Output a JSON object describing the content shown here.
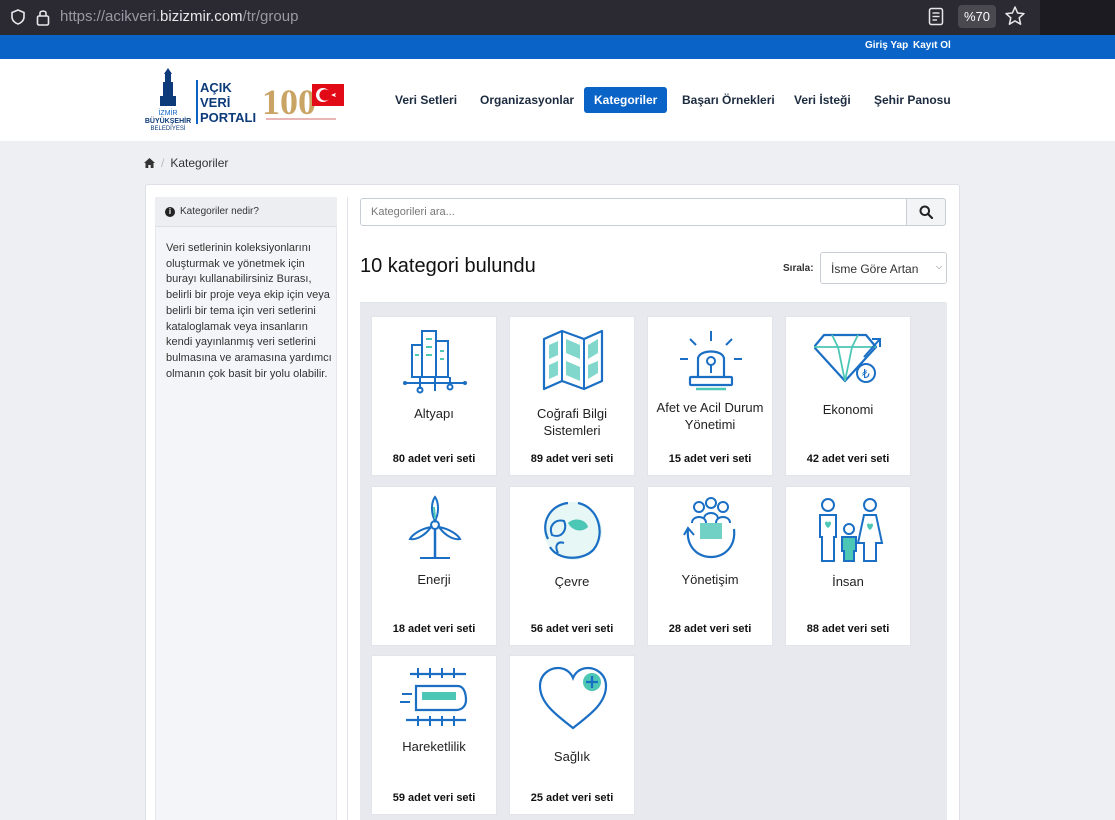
{
  "browser": {
    "url_prefix": "https://acikveri.",
    "url_domain": "bizizmir.com",
    "url_path": "/tr/group",
    "zoom": "%70"
  },
  "topbar": {
    "login": "Giriş Yap",
    "register": "Kayıt Ol"
  },
  "logo": {
    "izmir_line1": "İZMİR",
    "izmir_line2": "BÜYÜKŞEHİR",
    "izmir_line3": "BELEDİYESİ",
    "portal_line1": "AÇIK",
    "portal_line2": "VERİ",
    "portal_line3": "PORTALI"
  },
  "nav": {
    "datasets": "Veri Setleri",
    "organizations": "Organizasyonlar",
    "categories": "Kategoriler",
    "success": "Başarı Örnekleri",
    "request": "Veri İsteği",
    "dashboard": "Şehir Panosu"
  },
  "breadcrumb": {
    "current": "Kategoriler"
  },
  "sidebar": {
    "title": "Kategoriler nedir?",
    "body": "Veri setlerinin koleksiyonlarını oluşturmak ve yönetmek için burayı kullanabilirsiniz Burası, belirli bir proje veya ekip için veya belirli bir tema için veri setlerini kataloglamak veya insanların kendi yayınlanmış veri setlerini bulmasına ve aramasına yardımcı olmanın çok basit bir yolu olabilir."
  },
  "search": {
    "placeholder": "Kategorileri ara..."
  },
  "results": {
    "title": "10 kategori bulundu"
  },
  "sort": {
    "label": "Sırala:",
    "value": "İsme Göre Artan"
  },
  "categories": [
    {
      "name": "Altyapı",
      "count": "80 adet veri seti",
      "icon": "infrastructure-icon"
    },
    {
      "name": "Coğrafi Bilgi Sistemleri",
      "count": "89 adet veri seti",
      "icon": "map-icon"
    },
    {
      "name": "Afet ve Acil Durum Yönetimi",
      "count": "15 adet veri seti",
      "icon": "alarm-icon"
    },
    {
      "name": "Ekonomi",
      "count": "42 adet veri seti",
      "icon": "diamond-icon"
    },
    {
      "name": "Enerji",
      "count": "18 adet veri seti",
      "icon": "wind-turbine-icon"
    },
    {
      "name": "Çevre",
      "count": "56 adet veri seti",
      "icon": "globe-leaf-icon"
    },
    {
      "name": "Yönetişim",
      "count": "28 adet veri seti",
      "icon": "governance-icon"
    },
    {
      "name": "İnsan",
      "count": "88 adet veri seti",
      "icon": "people-icon"
    },
    {
      "name": "Hareketlilik",
      "count": "59 adet veri seti",
      "icon": "train-icon"
    },
    {
      "name": "Sağlık",
      "count": "25 adet veri seti",
      "icon": "heart-plus-icon"
    }
  ],
  "colors": {
    "brand": "#0a64c8",
    "icon_teal": "#4cc6b5",
    "icon_blue": "#1a6fc4"
  }
}
